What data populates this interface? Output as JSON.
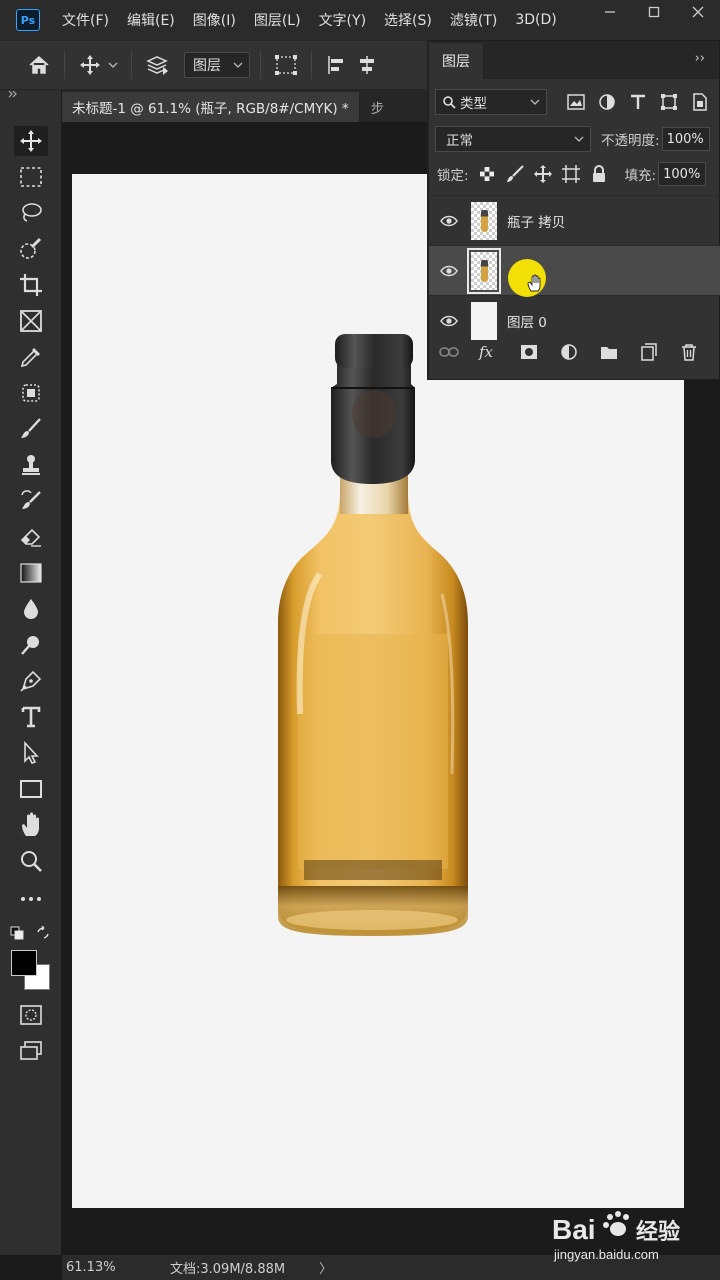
{
  "app": {
    "logo_text": "Ps"
  },
  "menu": [
    "文件(F)",
    "编辑(E)",
    "图像(I)",
    "图层(L)",
    "文字(Y)",
    "选择(S)",
    "滤镜(T)",
    "3D(D)"
  ],
  "options_bar": {
    "layer_select_value": "图层"
  },
  "document": {
    "tab_title": "未标题-1 @ 61.1% (瓶子, RGB/8#/CMYK) *",
    "next_tab_partial": "步"
  },
  "status_bar": {
    "zoom": "61.13%",
    "doc_size": "文档:3.09M/8.88M",
    "arrow": "〉"
  },
  "layers_panel": {
    "tab_label": "图层",
    "collapse_glyph": "››",
    "filter_select": "类型",
    "blend_mode": "正常",
    "opacity_label": "不透明度:",
    "opacity_value": "100%",
    "lock_label": "锁定:",
    "fill_label": "填充:",
    "fill_value": "100%",
    "layers": [
      {
        "name": "瓶子 拷贝",
        "visible": true,
        "selected": false
      },
      {
        "name": "",
        "visible": true,
        "selected": true
      },
      {
        "name": "图层 0",
        "visible": true,
        "selected": false
      }
    ]
  },
  "watermark": {
    "brand": "Bai",
    "brand_cn": "经验",
    "url": "jingyan.baidu.com"
  },
  "colors": {
    "accent": "#3aa0ff",
    "liquid": "#e2ab3e",
    "cap": "#2a2a2a",
    "canvas": "#f4f4f4",
    "highlight": "#ffec00"
  }
}
